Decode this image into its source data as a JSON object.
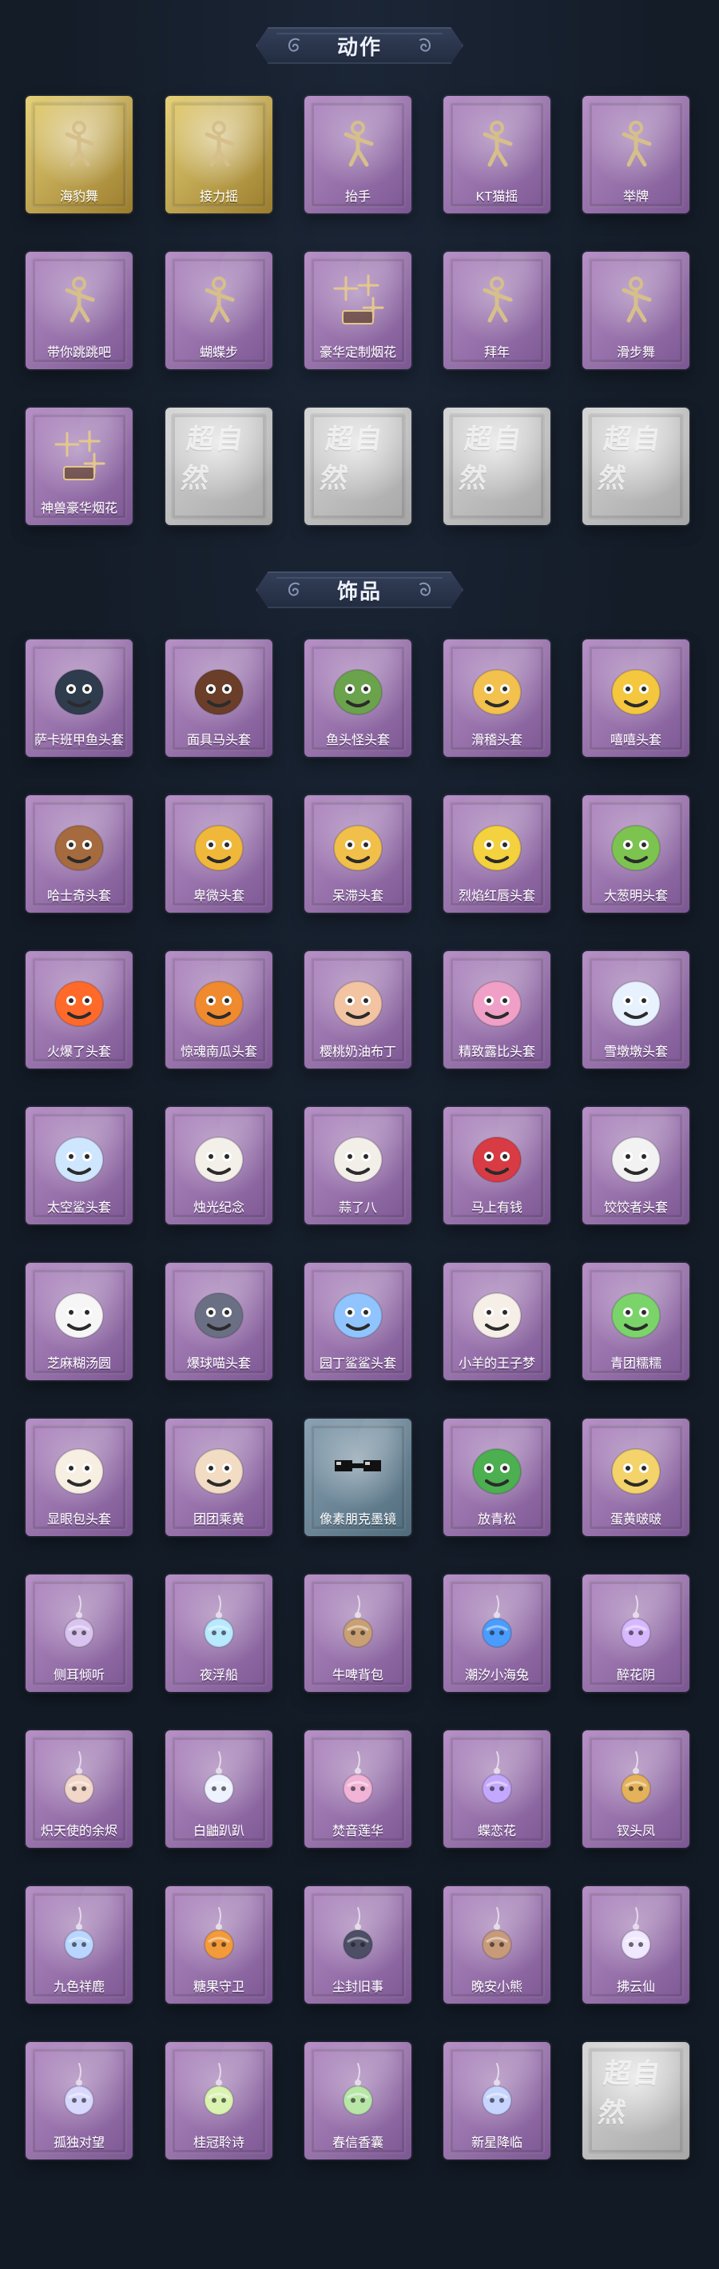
{
  "sections": {
    "actions": {
      "title": "动作",
      "items": [
        {
          "label": "海豹舞",
          "theme": "gold",
          "icon": "dancer-icon"
        },
        {
          "label": "接力摇",
          "theme": "gold",
          "icon": "dancer-icon"
        },
        {
          "label": "抬手",
          "theme": "purple",
          "icon": "dancer-icon"
        },
        {
          "label": "KT猫摇",
          "theme": "purple",
          "icon": "dancer-icon"
        },
        {
          "label": "举牌",
          "theme": "purple",
          "icon": "dancer-icon"
        },
        {
          "label": "带你跳跳吧",
          "theme": "purple",
          "icon": "dancer-icon"
        },
        {
          "label": "蝴蝶步",
          "theme": "purple",
          "icon": "dancer-icon"
        },
        {
          "label": "豪华定制烟花",
          "theme": "purple",
          "icon": "fireworks-icon"
        },
        {
          "label": "拜年",
          "theme": "purple",
          "icon": "dancer-icon"
        },
        {
          "label": "滑步舞",
          "theme": "purple",
          "icon": "dancer-icon"
        },
        {
          "label": "神兽豪华烟花",
          "theme": "purple",
          "icon": "fireworks-icon"
        },
        {
          "label": "",
          "theme": "gray",
          "icon": "placeholder-logo-icon"
        },
        {
          "label": "",
          "theme": "gray",
          "icon": "placeholder-logo-icon"
        },
        {
          "label": "",
          "theme": "gray",
          "icon": "placeholder-logo-icon"
        },
        {
          "label": "",
          "theme": "gray",
          "icon": "placeholder-logo-icon"
        }
      ]
    },
    "ornaments": {
      "title": "饰品",
      "items": [
        {
          "label": "萨卡班甲鱼头套",
          "theme": "purple",
          "icon": "fish-head-icon"
        },
        {
          "label": "面具马头套",
          "theme": "purple",
          "icon": "horse-head-icon"
        },
        {
          "label": "鱼头怪头套",
          "theme": "purple",
          "icon": "fish-monster-head-icon"
        },
        {
          "label": "滑稽头套",
          "theme": "purple",
          "icon": "smiley-head-icon"
        },
        {
          "label": "嘻嘻头套",
          "theme": "purple",
          "icon": "grin-head-icon"
        },
        {
          "label": "哈士奇头套",
          "theme": "purple",
          "icon": "husky-head-icon"
        },
        {
          "label": "卑微头套",
          "theme": "purple",
          "icon": "sad-face-head-icon"
        },
        {
          "label": "呆滞头套",
          "theme": "purple",
          "icon": "blank-face-head-icon"
        },
        {
          "label": "烈焰红唇头套",
          "theme": "purple",
          "icon": "red-lips-head-icon"
        },
        {
          "label": "大葱明头套",
          "theme": "purple",
          "icon": "green-onion-head-icon"
        },
        {
          "label": "火爆了头套",
          "theme": "purple",
          "icon": "fire-head-icon"
        },
        {
          "label": "惊魂南瓜头套",
          "theme": "purple",
          "icon": "pumpkin-head-icon"
        },
        {
          "label": "樱桃奶油布丁",
          "theme": "purple",
          "icon": "pudding-icon"
        },
        {
          "label": "精致露比头套",
          "theme": "purple",
          "icon": "pink-head-icon"
        },
        {
          "label": "雪墩墩头套",
          "theme": "purple",
          "icon": "snow-head-icon"
        },
        {
          "label": "太空鲨头套",
          "theme": "purple",
          "icon": "space-shark-head-icon"
        },
        {
          "label": "烛光纪念",
          "theme": "purple",
          "icon": "candle-icon"
        },
        {
          "label": "蒜了八",
          "theme": "purple",
          "icon": "garlic-icon"
        },
        {
          "label": "马上有钱",
          "theme": "purple",
          "icon": "red-horse-icon"
        },
        {
          "label": "饺饺者头套",
          "theme": "purple",
          "icon": "dumpling-head-icon"
        },
        {
          "label": "芝麻糊汤圆",
          "theme": "purple",
          "icon": "tangyuan-icon"
        },
        {
          "label": "爆球喵头套",
          "theme": "purple",
          "icon": "cat-head-icon"
        },
        {
          "label": "园丁鲨鲨头套",
          "theme": "purple",
          "icon": "shark-gardener-icon"
        },
        {
          "label": "小羊的王子梦",
          "theme": "purple",
          "icon": "sheep-prince-icon"
        },
        {
          "label": "青团糯糯",
          "theme": "purple",
          "icon": "green-bun-icon"
        },
        {
          "label": "显眼包头套",
          "theme": "purple",
          "icon": "crown-bun-icon"
        },
        {
          "label": "团团乘黄",
          "theme": "purple",
          "icon": "round-cat-icon"
        },
        {
          "label": "像素朋克墨镜",
          "theme": "blue",
          "icon": "pixel-sunglasses-icon"
        },
        {
          "label": "放青松",
          "theme": "purple",
          "icon": "bonsai-icon"
        },
        {
          "label": "蛋黄啵啵",
          "theme": "purple",
          "icon": "egg-yolk-icon"
        },
        {
          "label": "侧耳倾听",
          "theme": "purple",
          "icon": "ear-accessory-icon"
        },
        {
          "label": "夜浮船",
          "theme": "purple",
          "icon": "jellyfish-icon"
        },
        {
          "label": "牛啤背包",
          "theme": "purple",
          "icon": "beer-backpack-icon"
        },
        {
          "label": "潮汐小海兔",
          "theme": "purple",
          "icon": "sea-bunny-icon"
        },
        {
          "label": "醉花阴",
          "theme": "purple",
          "icon": "hair-ornament-icon"
        },
        {
          "label": "炽天使的余烬",
          "theme": "purple",
          "icon": "angel-doll-icon"
        },
        {
          "label": "白鼬趴趴",
          "theme": "purple",
          "icon": "ermine-plush-icon"
        },
        {
          "label": "焚音莲华",
          "theme": "purple",
          "icon": "lotus-doll-icon"
        },
        {
          "label": "蝶恋花",
          "theme": "purple",
          "icon": "butterfly-ornament-icon"
        },
        {
          "label": "钗头凤",
          "theme": "purple",
          "icon": "phoenix-doll-icon"
        },
        {
          "label": "九色祥鹿",
          "theme": "purple",
          "icon": "deer-charm-icon"
        },
        {
          "label": "糖果守卫",
          "theme": "purple",
          "icon": "candy-guard-icon"
        },
        {
          "label": "尘封旧事",
          "theme": "purple",
          "icon": "dark-doll-icon"
        },
        {
          "label": "晚安小熊",
          "theme": "purple",
          "icon": "bear-charm-icon"
        },
        {
          "label": "拂云仙",
          "theme": "purple",
          "icon": "cloud-fairy-icon"
        },
        {
          "label": "孤独对望",
          "theme": "purple",
          "icon": "lonely-charm-icon"
        },
        {
          "label": "桂冠聆诗",
          "theme": "purple",
          "icon": "laurel-charm-icon"
        },
        {
          "label": "春信香囊",
          "theme": "purple",
          "icon": "sachet-icon"
        },
        {
          "label": "新星降临",
          "theme": "purple",
          "icon": "star-charm-icon"
        },
        {
          "label": "",
          "theme": "gray",
          "icon": "placeholder-logo-icon"
        }
      ]
    }
  },
  "placeholder_logo_text": "超自然",
  "colors": {
    "page_bg": "#131b26",
    "header_fg": "#eef2ff",
    "purple_card": "#b690c6",
    "gold_card": "#e6d178",
    "gray_card": "#c8c8c8"
  }
}
